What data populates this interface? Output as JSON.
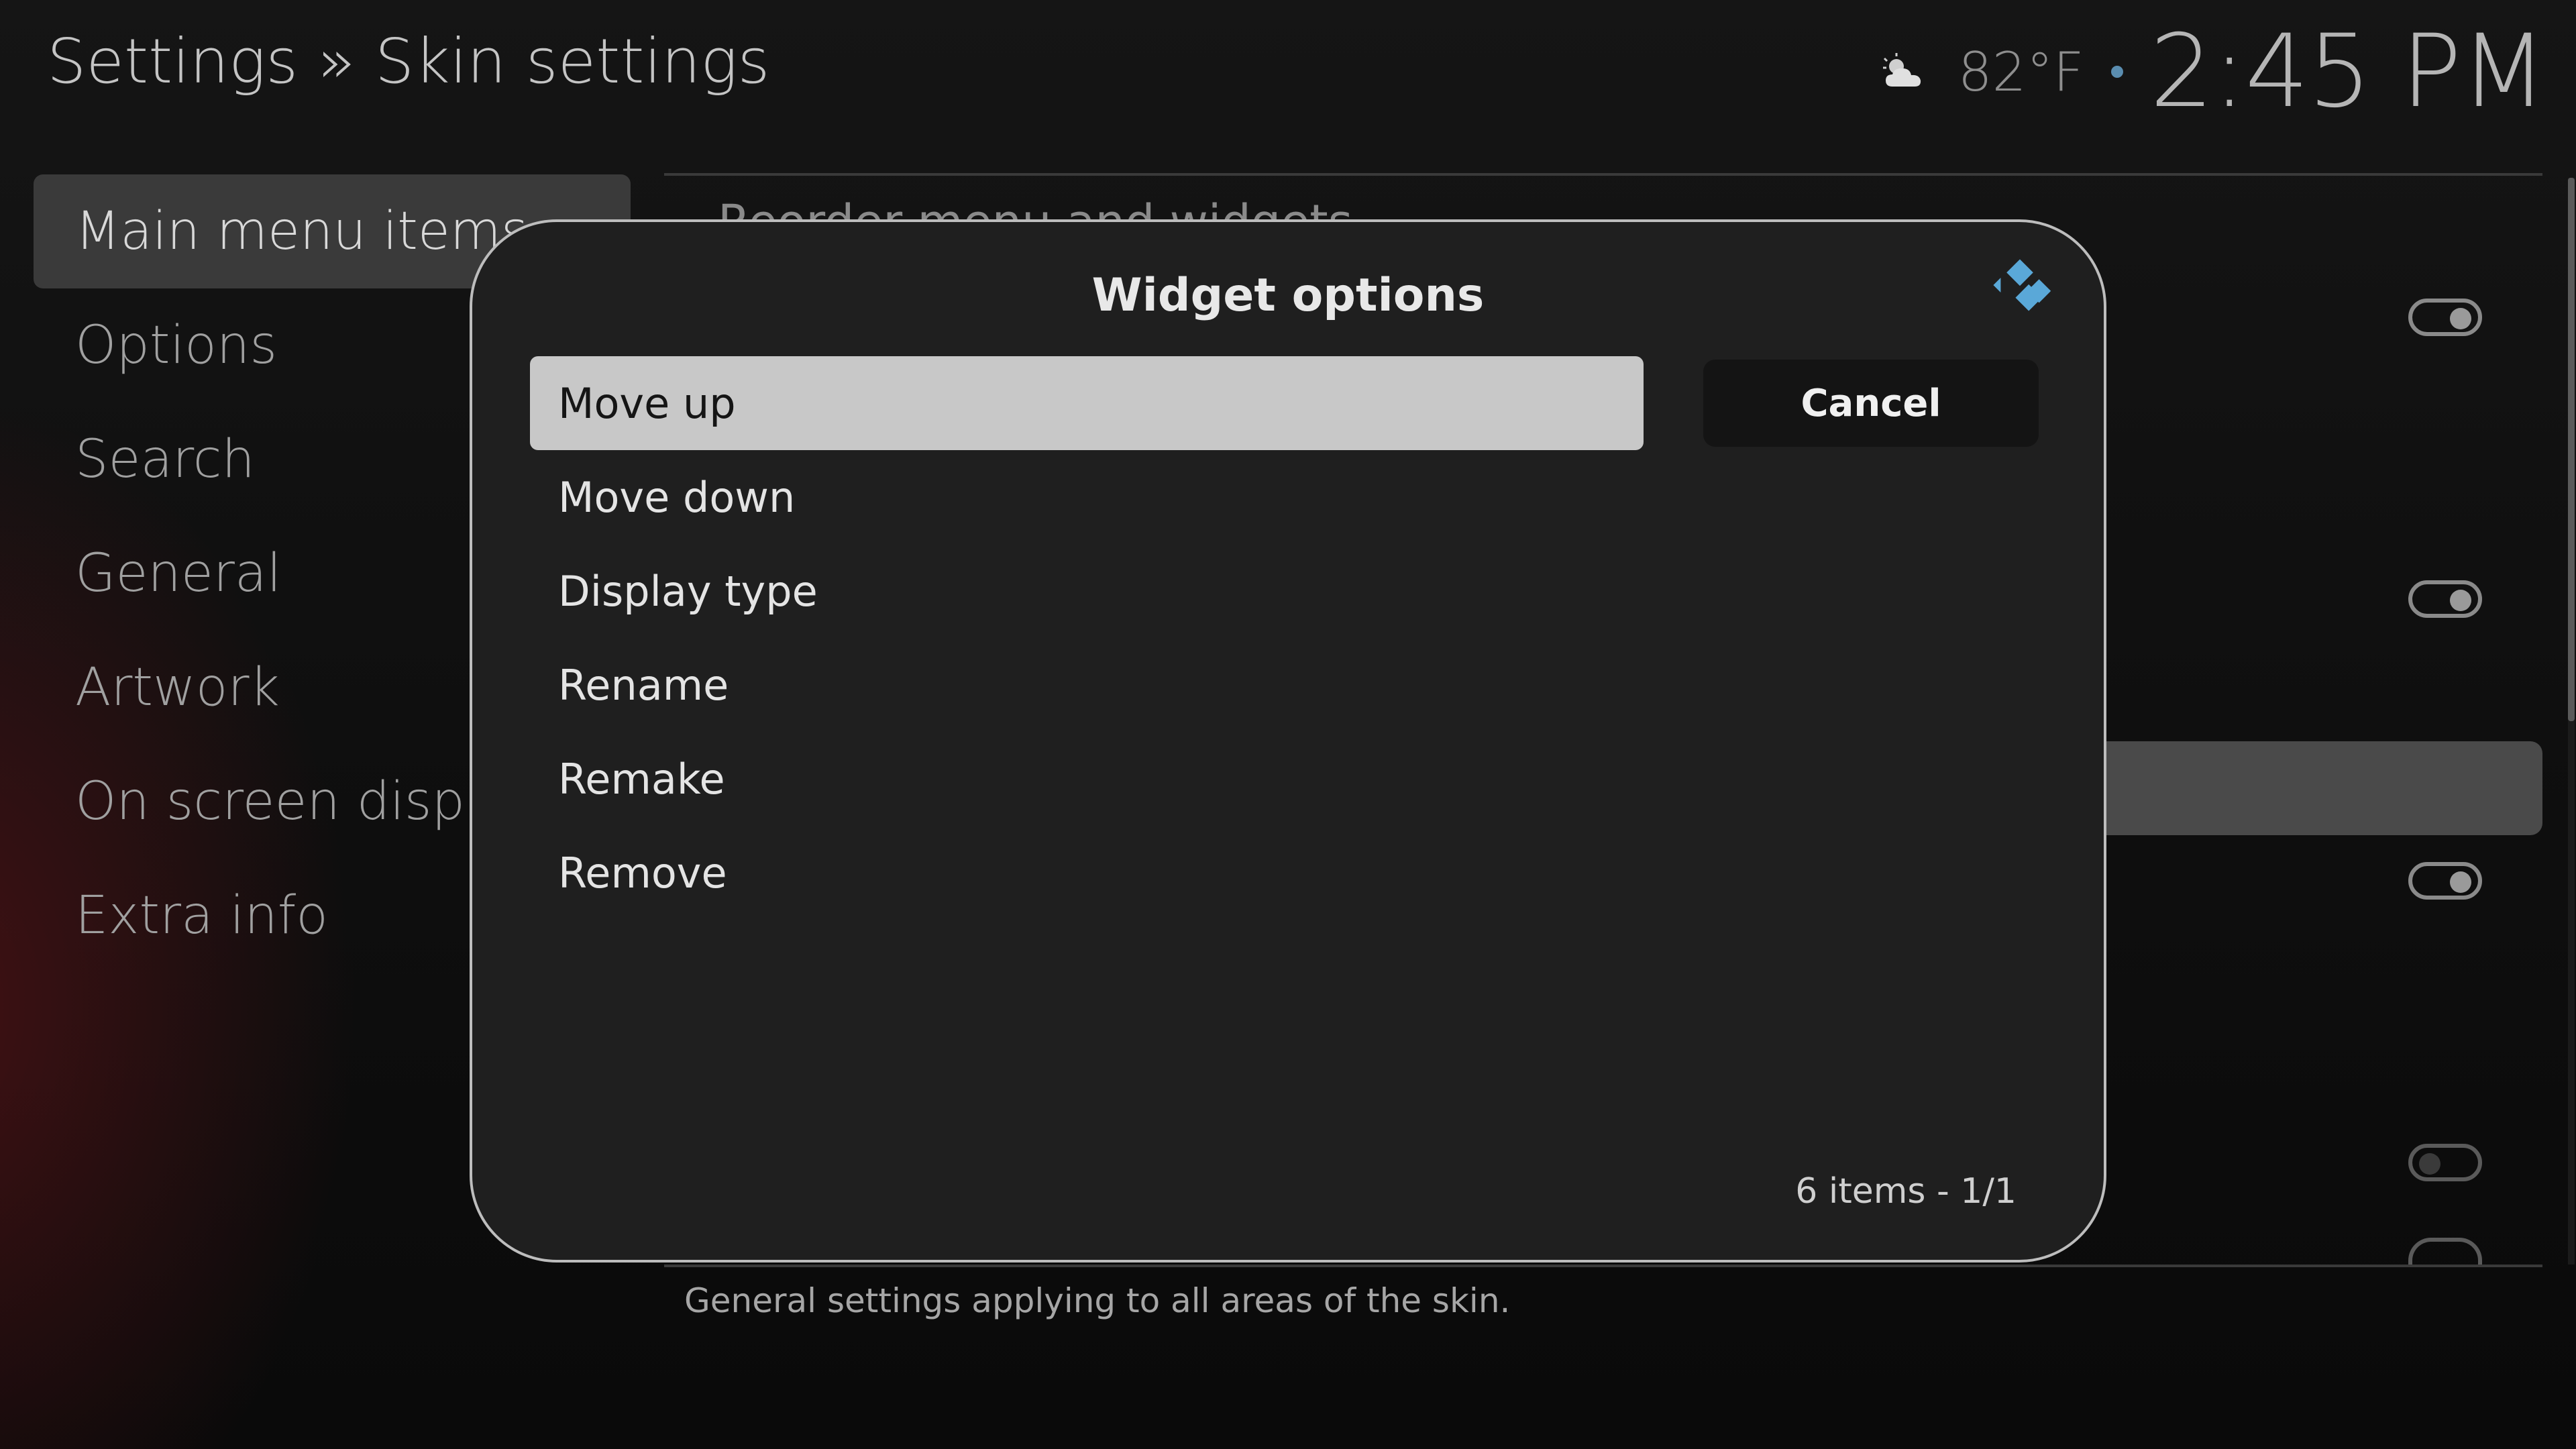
{
  "header": {
    "breadcrumb": "Settings » Skin settings",
    "weather_icon": "cloud-sun-icon",
    "temperature": "82°F",
    "time": "2:45 PM"
  },
  "sidebar": {
    "items": [
      {
        "label": "Main menu items",
        "active": true
      },
      {
        "label": "Options"
      },
      {
        "label": "Search"
      },
      {
        "label": "General"
      },
      {
        "label": "Artwork"
      },
      {
        "label": "On screen display"
      },
      {
        "label": "Extra info"
      }
    ]
  },
  "panel": {
    "peek_text": "Reorder menu and widgets",
    "toggles": [
      "on",
      "on",
      "on",
      "off",
      "off"
    ],
    "description": "General settings applying to all areas of the skin."
  },
  "dialog": {
    "title": "Widget options",
    "logo": "kodi-logo-icon",
    "options": [
      {
        "label": "Move up",
        "selected": true
      },
      {
        "label": "Move down"
      },
      {
        "label": "Display type"
      },
      {
        "label": "Rename"
      },
      {
        "label": "Remake"
      },
      {
        "label": "Remove"
      }
    ],
    "cancel_label": "Cancel",
    "item_count": "6 items - 1/1"
  },
  "colors": {
    "accent_blue": "#5aa8d8",
    "selected_bg": "#c8c8c8",
    "dialog_bg": "#1f1f1f"
  }
}
